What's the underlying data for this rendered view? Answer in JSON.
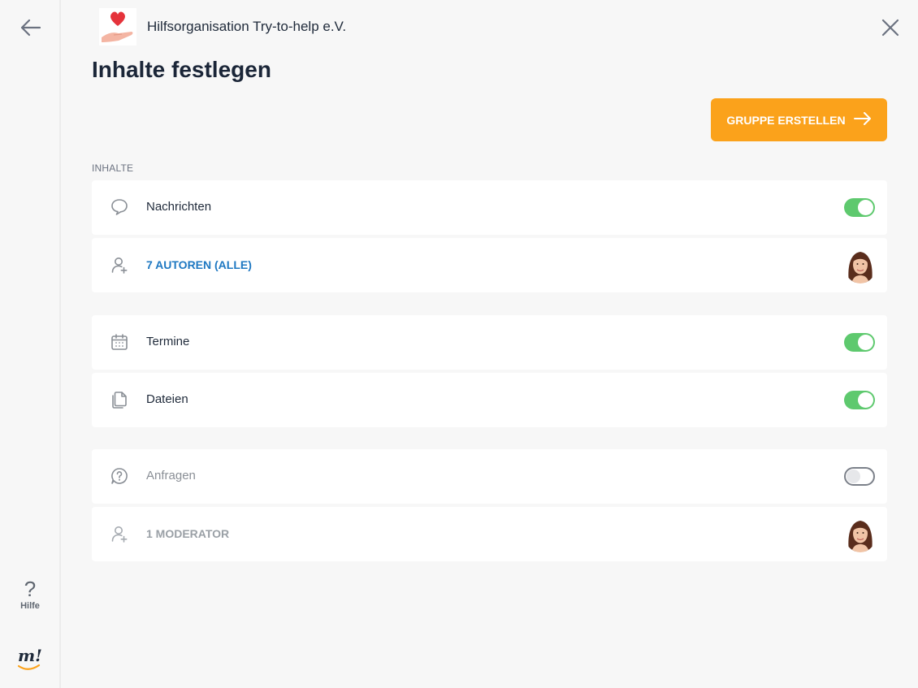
{
  "sidebar": {
    "help_label": "Hilfe",
    "brand_text": "m!"
  },
  "header": {
    "org_name": "Hilfsorganisation Try-to-help e.V.",
    "title": "Inhalte festlegen",
    "create_button_label": "GRUPPE ERSTELLEN"
  },
  "content": {
    "section_label": "INHALTE",
    "rows": [
      {
        "label": "Nachrichten",
        "icon": "speech-bubble-icon",
        "control": "toggle",
        "enabled": true
      },
      {
        "label": "7 AUTOREN (ALLE)",
        "icon": "add-person-icon",
        "control": "avatar"
      },
      {
        "label": "Termine",
        "icon": "calendar-icon",
        "control": "toggle",
        "enabled": true
      },
      {
        "label": "Dateien",
        "icon": "files-icon",
        "control": "toggle",
        "enabled": true
      },
      {
        "label": "Anfragen",
        "icon": "question-bubble-icon",
        "control": "toggle",
        "enabled": false
      },
      {
        "label": "1 MODERATOR",
        "icon": "add-person-icon",
        "control": "avatar"
      }
    ]
  },
  "colors": {
    "accent": "#fba21b",
    "toggle_on": "#5ec96e",
    "link": "#1e78c2"
  }
}
